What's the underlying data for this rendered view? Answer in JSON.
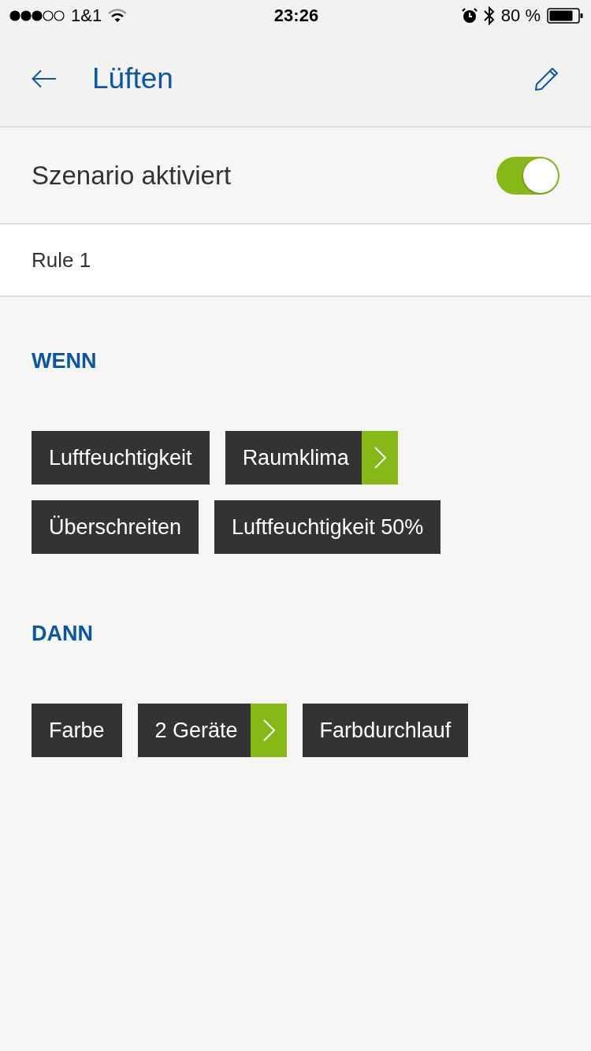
{
  "status_bar": {
    "carrier": "1&1",
    "time": "23:26",
    "battery": "80 %"
  },
  "header": {
    "title": "Lüften"
  },
  "scenario_toggle": {
    "label": "Szenario aktiviert",
    "on": true
  },
  "rule": {
    "name": "Rule 1"
  },
  "sections": [
    {
      "heading": "WENN",
      "chips": [
        {
          "label": "Luftfeuchtigkeit",
          "kind": "plain"
        },
        {
          "label": "Raumklima",
          "kind": "link"
        },
        {
          "label": "Überschreiten",
          "kind": "plain"
        },
        {
          "label": "Luftfeuchtigkeit 50%",
          "kind": "plain"
        }
      ]
    },
    {
      "heading": "DANN",
      "chips": [
        {
          "label": "Farbe",
          "kind": "plain"
        },
        {
          "label": "2 Geräte",
          "kind": "link"
        },
        {
          "label": "Farbdurchlauf",
          "kind": "plain"
        }
      ]
    }
  ]
}
